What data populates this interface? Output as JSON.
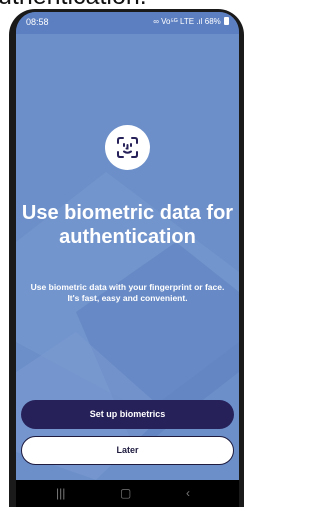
{
  "top_text": "uthentication.",
  "status_bar": {
    "time": "08:58",
    "signal_text": "Vo⁵ᴳ LTE .ıl",
    "battery": "68%"
  },
  "headline": "Use biometric data for authentication",
  "description": "Use biometric data with your fingerprint or face. It's fast, easy and convenient.",
  "buttons": {
    "primary": "Set up biometrics",
    "secondary": "Later"
  },
  "icons": {
    "face_id": "face-scan-icon",
    "link": "link-icon",
    "wifi": "wifi-icon",
    "battery": "battery-icon"
  },
  "colors": {
    "background": "#6c8fc9",
    "primary_button": "#27215a",
    "text": "#ffffff"
  }
}
